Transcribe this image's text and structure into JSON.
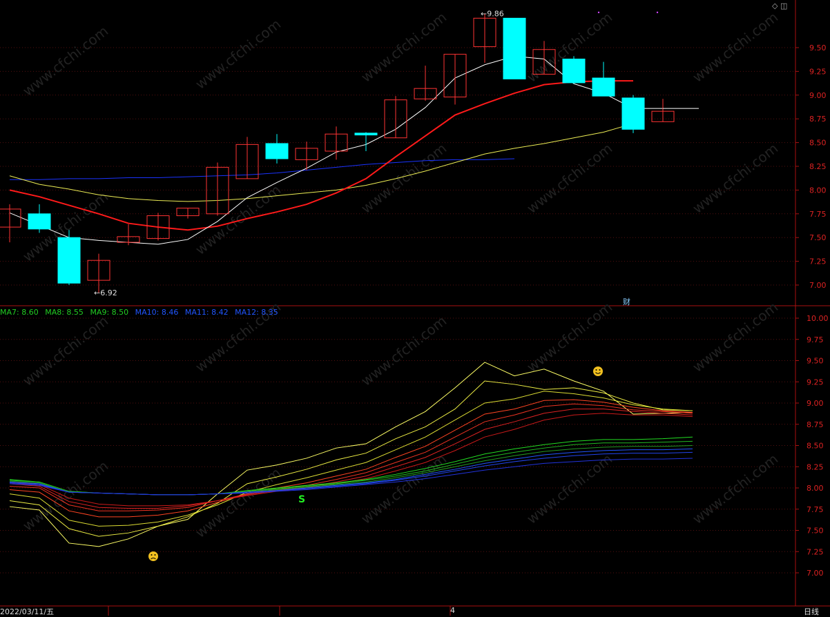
{
  "chart_data": [
    {
      "type": "candlestick",
      "title": "",
      "ylim": [
        6.78,
        9.98
      ],
      "yticks": [
        "7.00",
        "7.25",
        "7.50",
        "7.75",
        "8.00",
        "8.25",
        "8.50",
        "8.75",
        "9.00",
        "9.25",
        "9.50"
      ],
      "high_marker": "9.86",
      "low_marker": "6.92",
      "candles": [
        {
          "o": 7.61,
          "c": 7.8,
          "h": 7.85,
          "l": 7.45
        },
        {
          "o": 7.75,
          "c": 7.59,
          "h": 7.85,
          "l": 7.55
        },
        {
          "o": 7.5,
          "c": 7.02,
          "h": 7.58,
          "l": 7.0
        },
        {
          "o": 7.05,
          "c": 7.26,
          "h": 7.33,
          "l": 6.92
        },
        {
          "o": 7.45,
          "c": 7.51,
          "h": 7.64,
          "l": 7.42
        },
        {
          "o": 7.49,
          "c": 7.73,
          "h": 7.76,
          "l": 7.47
        },
        {
          "o": 7.73,
          "c": 7.81,
          "h": 7.81,
          "l": 7.7
        },
        {
          "o": 7.75,
          "c": 8.24,
          "h": 8.29,
          "l": 7.73
        },
        {
          "o": 8.12,
          "c": 8.48,
          "h": 8.56,
          "l": 8.12
        },
        {
          "o": 8.49,
          "c": 8.33,
          "h": 8.59,
          "l": 8.28
        },
        {
          "o": 8.32,
          "c": 8.44,
          "h": 8.51,
          "l": 8.21
        },
        {
          "o": 8.41,
          "c": 8.59,
          "h": 8.67,
          "l": 8.32
        },
        {
          "o": 8.6,
          "c": 8.58,
          "h": 8.61,
          "l": 8.41
        },
        {
          "o": 8.55,
          "c": 8.95,
          "h": 8.99,
          "l": 8.55
        },
        {
          "o": 8.96,
          "c": 9.07,
          "h": 9.31,
          "l": 8.94
        },
        {
          "o": 8.98,
          "c": 9.43,
          "h": 9.43,
          "l": 8.9
        },
        {
          "o": 9.51,
          "c": 9.81,
          "h": 9.86,
          "l": 9.34
        },
        {
          "o": 9.81,
          "c": 9.17,
          "h": 9.81,
          "l": 9.17
        },
        {
          "o": 9.22,
          "c": 9.48,
          "h": 9.57,
          "l": 9.22
        },
        {
          "o": 9.38,
          "c": 9.13,
          "h": 9.41,
          "l": 9.12
        },
        {
          "o": 9.18,
          "c": 8.99,
          "h": 9.35,
          "l": 8.99
        },
        {
          "o": 8.97,
          "c": 8.64,
          "h": 9.0,
          "l": 8.6
        },
        {
          "o": 8.72,
          "c": 8.83,
          "h": 8.96,
          "l": 8.72
        }
      ],
      "ma_white": [
        7.76,
        7.63,
        7.5,
        7.47,
        7.45,
        7.43,
        7.48,
        7.67,
        7.92,
        8.08,
        8.23,
        8.4,
        8.48,
        8.64,
        8.87,
        9.18,
        9.32,
        9.41,
        9.38,
        9.12,
        9.02,
        8.86,
        8.86
      ],
      "ma_red": [
        8.0,
        7.93,
        7.84,
        7.75,
        7.65,
        7.61,
        7.58,
        7.62,
        7.7,
        7.77,
        7.85,
        7.97,
        8.12,
        8.35,
        8.57,
        8.79,
        8.91,
        9.02,
        9.11,
        9.14,
        9.15,
        9.15
      ],
      "ma_yellow": [
        8.15,
        8.06,
        8.01,
        7.95,
        7.91,
        7.89,
        7.88,
        7.89,
        7.91,
        7.94,
        7.97,
        8.0,
        8.05,
        8.12,
        8.2,
        8.29,
        8.38,
        8.44,
        8.49,
        8.55,
        8.61,
        8.7
      ],
      "ma_blue": [
        8.11,
        8.11,
        8.12,
        8.12,
        8.13,
        8.13,
        8.14,
        8.15,
        8.16,
        8.18,
        8.21,
        8.24,
        8.27,
        8.29,
        8.31,
        8.32,
        8.32,
        8.33
      ]
    },
    {
      "type": "line",
      "title": "",
      "ylim": [
        6.78,
        10.12
      ],
      "yticks": [
        "7.00",
        "7.25",
        "7.50",
        "7.75",
        "8.00",
        "8.25",
        "8.50",
        "8.75",
        "9.00",
        "9.25",
        "9.50",
        "9.75",
        "10.00"
      ],
      "legend": [
        {
          "name": "MA7: 8.60",
          "color": "#22cc22"
        },
        {
          "name": "MA8: 8.55",
          "color": "#22cc22"
        },
        {
          "name": "MA9: 8.50",
          "color": "#22cc22"
        },
        {
          "name": "MA10: 8.46",
          "color": "#2255ff"
        },
        {
          "name": "MA11: 8.42",
          "color": "#2255ff"
        },
        {
          "name": "MA12: 8.35",
          "color": "#2255ff"
        }
      ],
      "signal_s": "S",
      "series": [
        {
          "color": "#ffff66",
          "values": [
            7.78,
            7.74,
            7.35,
            7.31,
            7.4,
            7.55,
            7.63,
            7.93,
            8.21,
            8.27,
            8.35,
            8.47,
            8.52,
            8.72,
            8.9,
            9.18,
            9.48,
            9.32,
            9.4,
            9.26,
            9.14,
            8.87,
            8.88,
            8.89
          ]
        },
        {
          "color": "#eeee44",
          "values": [
            7.85,
            7.8,
            7.52,
            7.43,
            7.47,
            7.55,
            7.66,
            7.82,
            8.05,
            8.13,
            8.22,
            8.33,
            8.41,
            8.58,
            8.72,
            8.93,
            9.26,
            9.22,
            9.16,
            9.18,
            9.12,
            9.0,
            8.92,
            8.91
          ]
        },
        {
          "color": "#dddd33",
          "values": [
            7.93,
            7.88,
            7.62,
            7.55,
            7.56,
            7.6,
            7.68,
            7.8,
            7.95,
            8.04,
            8.12,
            8.21,
            8.3,
            8.45,
            8.6,
            8.8,
            9.0,
            9.05,
            9.14,
            9.11,
            9.06,
            8.98,
            8.93,
            8.91
          ]
        },
        {
          "color": "#ff4422",
          "values": [
            7.98,
            7.95,
            7.73,
            7.66,
            7.66,
            7.68,
            7.73,
            7.83,
            7.93,
            8.0,
            8.06,
            8.14,
            8.22,
            8.36,
            8.49,
            8.68,
            8.87,
            8.93,
            9.03,
            9.04,
            9.01,
            8.95,
            8.91,
            8.89
          ]
        },
        {
          "color": "#ee3322",
          "values": [
            8.02,
            8.0,
            7.8,
            7.73,
            7.73,
            7.74,
            7.77,
            7.85,
            7.93,
            7.98,
            8.03,
            8.1,
            8.18,
            8.3,
            8.42,
            8.6,
            8.78,
            8.86,
            8.96,
            8.99,
            8.97,
            8.92,
            8.9,
            8.88
          ]
        },
        {
          "color": "#dd2222",
          "values": [
            8.05,
            8.02,
            7.84,
            7.77,
            7.76,
            7.76,
            7.79,
            7.85,
            7.92,
            7.97,
            8.01,
            8.07,
            8.14,
            8.25,
            8.36,
            8.52,
            8.69,
            8.78,
            8.88,
            8.93,
            8.93,
            8.9,
            8.88,
            8.86
          ]
        },
        {
          "color": "#cc1a1a",
          "values": [
            8.07,
            8.04,
            7.88,
            7.81,
            7.79,
            7.79,
            7.8,
            7.85,
            7.91,
            7.96,
            8.0,
            8.05,
            8.11,
            8.2,
            8.3,
            8.44,
            8.6,
            8.69,
            8.8,
            8.86,
            8.88,
            8.86,
            8.86,
            8.84
          ]
        },
        {
          "color": "#22dd22",
          "values": [
            8.1,
            8.07,
            7.96,
            7.94,
            7.93,
            7.92,
            7.92,
            7.93,
            7.97,
            8.0,
            8.03,
            8.06,
            8.1,
            8.16,
            8.23,
            8.31,
            8.4,
            8.46,
            8.51,
            8.55,
            8.57,
            8.57,
            8.58,
            8.6
          ]
        },
        {
          "color": "#22bb22",
          "values": [
            8.09,
            8.07,
            7.96,
            7.94,
            7.93,
            7.92,
            7.92,
            7.93,
            7.96,
            7.99,
            8.02,
            8.05,
            8.09,
            8.14,
            8.2,
            8.28,
            8.36,
            8.42,
            8.47,
            8.51,
            8.53,
            8.53,
            8.54,
            8.55
          ]
        },
        {
          "color": "#229922",
          "values": [
            8.08,
            8.06,
            7.95,
            7.94,
            7.93,
            7.92,
            7.92,
            7.93,
            7.96,
            7.98,
            8.01,
            8.04,
            8.07,
            8.12,
            8.18,
            8.25,
            8.32,
            8.38,
            8.43,
            8.46,
            8.48,
            8.49,
            8.49,
            8.5
          ]
        },
        {
          "color": "#2255ff",
          "values": [
            8.07,
            8.05,
            7.95,
            7.94,
            7.93,
            7.92,
            7.92,
            7.93,
            7.95,
            7.97,
            8.0,
            8.03,
            8.06,
            8.1,
            8.16,
            8.22,
            8.29,
            8.34,
            8.39,
            8.42,
            8.44,
            8.45,
            8.45,
            8.46
          ]
        },
        {
          "color": "#2244ee",
          "values": [
            8.06,
            8.04,
            7.95,
            7.94,
            7.93,
            7.92,
            7.92,
            7.93,
            7.95,
            7.97,
            7.99,
            8.02,
            8.05,
            8.09,
            8.14,
            8.2,
            8.26,
            8.31,
            8.35,
            8.38,
            8.4,
            8.41,
            8.41,
            8.42
          ]
        },
        {
          "color": "#2233dd",
          "values": [
            8.05,
            8.03,
            7.95,
            7.94,
            7.93,
            7.92,
            7.92,
            7.93,
            7.94,
            7.96,
            7.98,
            8.01,
            8.04,
            8.07,
            8.11,
            8.16,
            8.21,
            8.25,
            8.29,
            8.31,
            8.33,
            8.34,
            8.34,
            8.35
          ]
        }
      ]
    }
  ],
  "footer": {
    "date": "2022/03/11/五",
    "period": "日线",
    "month_tick": "4"
  },
  "markers": {
    "cai": "财",
    "top_icons": "◇ ◫"
  },
  "watermark": "www.cfchi.com"
}
